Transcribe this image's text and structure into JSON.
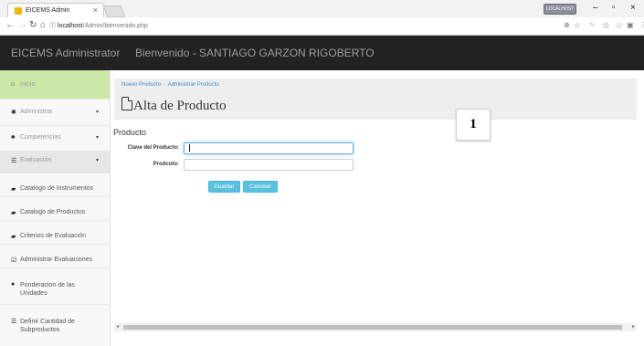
{
  "browser": {
    "tab_title": "EICEMS Admin",
    "tab_close": "×",
    "window_badge": "LOCALHOST",
    "window_min": "–",
    "window_max": "▫",
    "window_close": "×",
    "url_host": "localhost",
    "url_path": "/Admin/bienvenido.php"
  },
  "navbar": {
    "brand": "EICEMS Administrator",
    "welcome": "Bienvenido - SANTIAGO GARZON RIGOBERTO"
  },
  "sidebar": {
    "items": [
      {
        "icon": "home-icon",
        "label": "Inicio",
        "active": true
      },
      {
        "icon": "gear-icon",
        "label": "Administrar",
        "caret": "▾"
      },
      {
        "icon": "users-icon",
        "label": "Competencias",
        "caret": "▾"
      },
      {
        "icon": "list-icon",
        "label": "Evaluación",
        "caret": "▾"
      },
      {
        "icon": "book-icon",
        "label": "Catalogo de Instrumentos"
      },
      {
        "icon": "book-icon",
        "label": "Catalogo de Productos"
      },
      {
        "icon": "book-icon",
        "label": "Criterios de Evaluación"
      },
      {
        "icon": "edit-icon",
        "label": "Administrar Evaluaciones"
      },
      {
        "icon": "circle-icon",
        "label": "Ponderacion de las Unidades"
      },
      {
        "icon": "list-icon",
        "label": "Definir Cantidad de Subproductos"
      }
    ]
  },
  "breadcrumb": {
    "items": [
      "Nuevo Producto",
      "Administrar Producto"
    ],
    "separator": "/"
  },
  "page": {
    "title": "Alta de Producto",
    "step_badge": "1",
    "section_title": "Producto"
  },
  "form": {
    "clave_label": "Clave del Producto:",
    "clave_value": "",
    "producto_label": "Prodcuto:",
    "producto_value": "",
    "guardar_label": "Guardar",
    "cancelar_label": "Cancelar"
  },
  "colors": {
    "navbar_bg": "#222222",
    "sidebar_active": "#cbe9a6",
    "button_info": "#5bc0de",
    "link": "#428bca"
  }
}
